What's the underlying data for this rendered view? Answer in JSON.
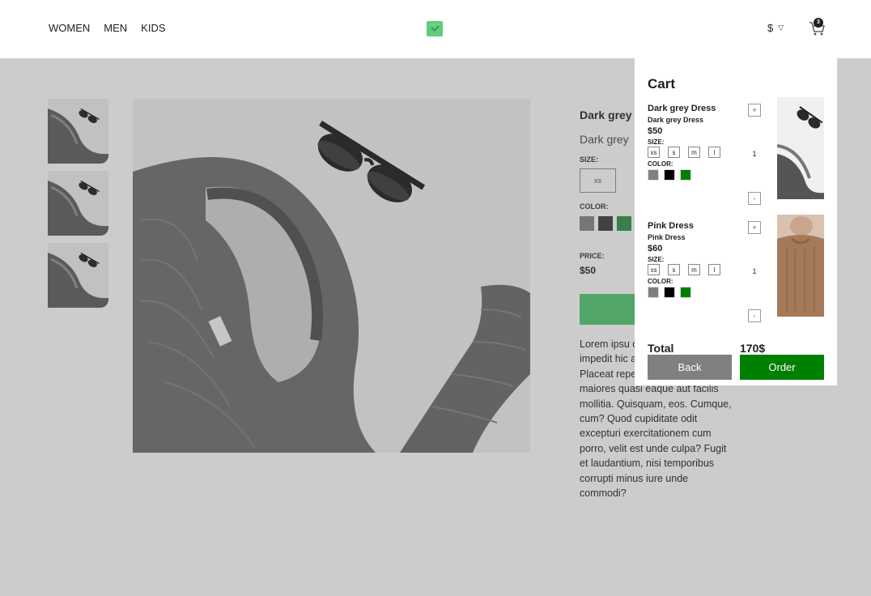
{
  "nav": {
    "items": [
      "WOMEN",
      "MEN",
      "KIDS"
    ]
  },
  "header": {
    "currency_symbol": "$",
    "cart_count": "3"
  },
  "product": {
    "brand": "Dark grey",
    "name": "Dark grey",
    "size_label": "SIZE:",
    "sizes": [
      "xs"
    ],
    "color_label": "COLOR:",
    "colors": [
      "#8e8e8e",
      "#4a4a4a",
      "#3f9a52"
    ],
    "price_label": "PRICE:",
    "price": "$50",
    "description": "Lorem ipsu consectetu Laboriosam impedit hic aliquid officia sunt! Placeat repellendus quis est officiis maiores quasi eaque aut facilis mollitia. Quisquam, eos. Cumque, cum? Quod cupiditate odit excepturi exercitationem cum porro, velit est unde culpa? Fugit et laudantium, nisi temporibus corrupti minus iure unde commodi?"
  },
  "cart": {
    "title": "Cart",
    "items": [
      {
        "name": "Dark grey Dress",
        "subname": "Dark grey Dress",
        "price": "$50",
        "size_label": "SIZE:",
        "sizes": [
          "xs",
          "s",
          "m",
          "l"
        ],
        "color_label": "COLOR:",
        "colors": [
          "#808080",
          "#000000",
          "#008000"
        ],
        "plus": "+",
        "qty": "1",
        "minus": "-"
      },
      {
        "name": "Pink Dress",
        "subname": "Pink Dress",
        "price": "$60",
        "size_label": "SIZE:",
        "sizes": [
          "xs",
          "s",
          "m",
          "l"
        ],
        "color_label": "COLOR:",
        "colors": [
          "#808080",
          "#000000",
          "#008000"
        ],
        "plus": "+",
        "qty": "1",
        "minus": "-"
      }
    ],
    "total_label": "Total",
    "total_value": "170$",
    "back_label": "Back",
    "order_label": "Order"
  },
  "icons": {
    "logo": "shopping-bag-logo-icon",
    "currency_toggle": "chevron-down-icon",
    "cart": "cart-icon"
  },
  "colors": {
    "logo": "#5ece7b",
    "add_button": "#5ece7b",
    "order_button": "#008000",
    "back_button": "#808080"
  }
}
